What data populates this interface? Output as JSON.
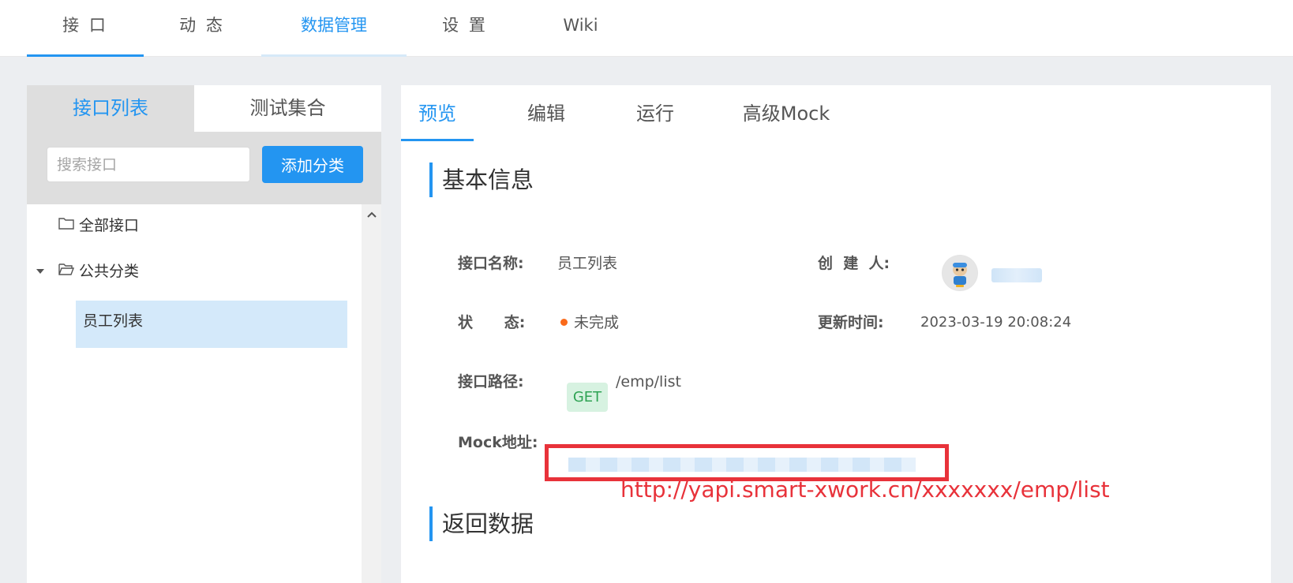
{
  "top_nav": {
    "tabs": [
      {
        "label": "接 口"
      },
      {
        "label": "动 态"
      },
      {
        "label": "数据管理"
      },
      {
        "label": "设 置"
      },
      {
        "label": "Wiki"
      }
    ]
  },
  "sidebar": {
    "tabs": [
      {
        "label": "接口列表"
      },
      {
        "label": "测试集合"
      }
    ],
    "search_placeholder": "搜索接口",
    "add_category_label": "添加分类",
    "tree": {
      "all_label": "全部接口",
      "category_label": "公共分类",
      "items": [
        {
          "label": "员工列表"
        }
      ]
    }
  },
  "main": {
    "tabs": [
      {
        "label": "预览"
      },
      {
        "label": "编辑"
      },
      {
        "label": "运行"
      },
      {
        "label": "高级Mock"
      }
    ],
    "basic_info_title": "基本信息",
    "return_data_title": "返回数据",
    "fields": {
      "name_label": "接口名称:",
      "name_value": "员工列表",
      "creator_label": "创  建  人:",
      "status_label": "状      态:",
      "status_value": "未完成",
      "status_color": "#fa6a1a",
      "updated_label": "更新时间:",
      "updated_value": "2023-03-19 20:08:24",
      "path_label": "接口路径:",
      "method": "GET",
      "path_value": "/emp/list",
      "mock_label": "Mock地址:"
    },
    "mock_url_annotation": "http://yapi.smart-xwork.cn/xxxxxxx/emp/list"
  },
  "colors": {
    "accent": "#2395f1",
    "annotation_red": "#e8323a",
    "get_badge_bg": "#d7f2e1",
    "get_badge_text": "#2fa354"
  }
}
